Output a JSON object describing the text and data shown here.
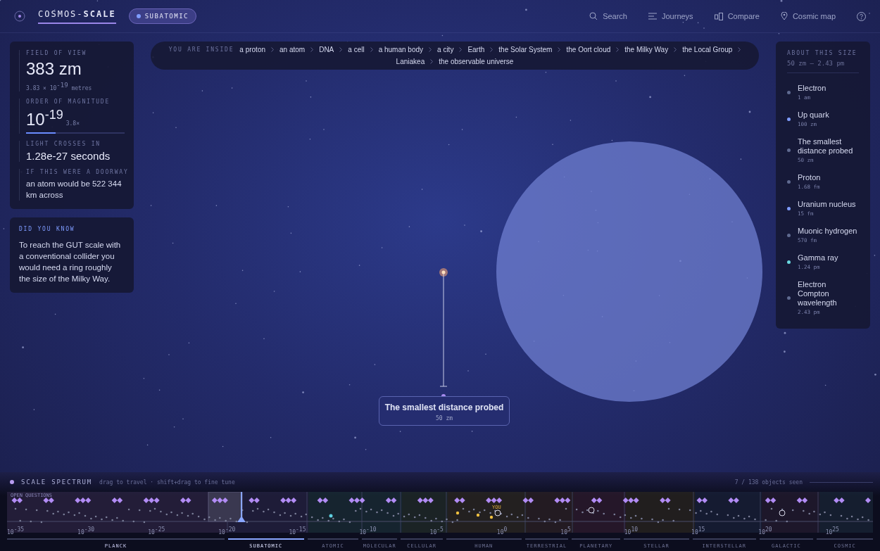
{
  "header": {
    "logo": "COSMOS-**SCALE**",
    "scale_badge": "SUBATOMIC",
    "nav": [
      {
        "label": "Search"
      },
      {
        "label": "Journeys"
      },
      {
        "label": "Compare"
      },
      {
        "label": "Cosmic map"
      }
    ]
  },
  "breadcrumb": {
    "label": "YOU ARE INSIDE",
    "items": [
      "a proton",
      "an atom",
      "DNA",
      "a cell",
      "a human body",
      "a city",
      "Earth",
      "the Solar System",
      "the Oort cloud",
      "the Milky Way",
      "the Local Group",
      "Laniakea",
      "the observable universe"
    ]
  },
  "stats": [
    {
      "kind": "value",
      "label": "FIELD OF VIEW",
      "value": "383 zm",
      "detail": "3.83 × 10$^{-19}$ metres"
    },
    {
      "kind": "magnitude",
      "label": "ORDER OF MAGNITUDE",
      "value": "10$^{-19}$",
      "detail": "3.8×",
      "level": 0.3
    },
    {
      "kind": "value",
      "label": "LIGHT CROSSES IN",
      "value": "1.28e-27 seconds"
    },
    {
      "kind": "sentence",
      "label": "IF THIS WERE A DOORWAY",
      "value": "an atom would be 522 344 km across"
    }
  ],
  "fact": {
    "label": "DID YOU KNOW",
    "text": "To reach the GUT scale with a conventional collider you would need a ring roughly the size of the Milky Way."
  },
  "size_panel": {
    "label": "ABOUT THIS SIZE",
    "range": "50 zm – 2.43 pm",
    "items": [
      {
        "name": "Electron",
        "size": "1 am",
        "color": "#5f6a90"
      },
      {
        "name": "Up quark",
        "size": "100 zm",
        "color": "#7f9cff"
      },
      {
        "name": "The smallest distance probed",
        "size": "50 zm",
        "color": "#5f6a90"
      },
      {
        "name": "Proton",
        "size": "1.68 fm",
        "color": "#5f6a90"
      },
      {
        "name": "Uranium nucleus",
        "size": "15 fm",
        "color": "#7f9cff"
      },
      {
        "name": "Muonic hydrogen",
        "size": "570 fm",
        "color": "#5f6a90"
      },
      {
        "name": "Gamma ray",
        "size": "1.24 pm",
        "color": "#6ad8e0"
      },
      {
        "name": "Electron Compton wavelength",
        "size": "2.43 pm",
        "color": "#5f6a90"
      }
    ]
  },
  "probe": {
    "title": "The smallest distance probed",
    "size": "50 zm"
  },
  "spectrum": {
    "title": "SCALE SPECTRUM",
    "hint": "drag to travel · shift+drag to fine tune",
    "seen": "7 / 138 objects seen",
    "track_label": "OPEN QUESTIONS",
    "you_label": "YOU",
    "ticks": [
      "10$^{-35}$",
      "10$^{-30}$",
      "10$^{-25}$",
      "10$^{-20}$",
      "10$^{-15}$",
      "10$^{-10}$",
      "10$^{-5}$",
      "10$^{0}$",
      "10$^{5}$",
      "10$^{10}$",
      "10$^{15}$",
      "10$^{20}$",
      "10$^{25}$"
    ],
    "bands": [
      {
        "label": "PLANCK",
        "selected": false
      },
      {
        "label": "SUBATOMIC",
        "selected": true
      },
      {
        "label": "ATOMIC",
        "selected": false
      },
      {
        "label": "MOLECULAR",
        "selected": false
      },
      {
        "label": "CELLULAR",
        "selected": false
      },
      {
        "label": "HUMAN",
        "selected": false
      },
      {
        "label": "TERRESTRIAL",
        "selected": false
      },
      {
        "label": "PLANETARY",
        "selected": false
      },
      {
        "label": "STELLAR",
        "selected": false
      },
      {
        "label": "INTERSTELLAR",
        "selected": false
      },
      {
        "label": "GALACTIC",
        "selected": false
      },
      {
        "label": "COSMIC",
        "selected": false
      }
    ]
  }
}
